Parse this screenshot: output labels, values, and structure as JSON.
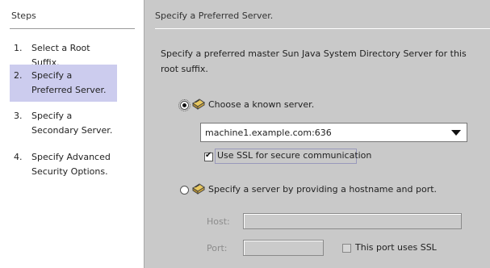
{
  "sidebar": {
    "title": "Steps",
    "steps": [
      {
        "num": "1.",
        "label": "Select a Root Suffix."
      },
      {
        "num": "2.",
        "label": "Specify a Preferred Server."
      },
      {
        "num": "3.",
        "label": "Specify a Secondary Server."
      },
      {
        "num": "4.",
        "label": "Specify Advanced Security Options."
      }
    ],
    "active_step": 2
  },
  "main": {
    "title": "Specify a Preferred Server.",
    "description": "Specify a preferred master Sun Java System Directory Server for this root suffix.",
    "known_server": {
      "label": "Choose a known server.",
      "selected": true,
      "combo_value": "machine1.example.com:636",
      "ssl_label": "Use SSL for secure communication",
      "ssl_checked": true
    },
    "custom_server": {
      "label": "Specify a server by providing a hostname and port.",
      "selected": false,
      "host_label": "Host:",
      "host_value": "",
      "port_label": "Port:",
      "port_value": "",
      "port_ssl_label": "This port uses SSL",
      "port_ssl_checked": false
    }
  },
  "colors": {
    "sidebar_bg": "#ffffff",
    "active_step_bg": "#ccccee",
    "panel_bg": "#c9c9c9",
    "disabled_text": "#8c8c8c"
  },
  "icons": [
    "server-icon",
    "dropdown-arrow-icon",
    "checkmark-icon",
    "radio-button-icon"
  ]
}
